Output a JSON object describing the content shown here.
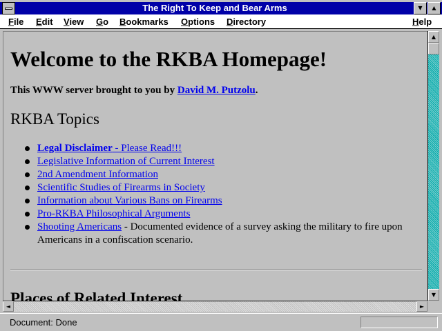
{
  "window": {
    "title": "The Right To Keep and Bear Arms"
  },
  "menu": {
    "file": "File",
    "edit": "Edit",
    "view": "View",
    "go": "Go",
    "bookmarks": "Bookmarks",
    "options": "Options",
    "directory": "Directory",
    "help": "Help"
  },
  "page": {
    "heading": "Welcome to the RKBA Homepage!",
    "byline_prefix": "This WWW server brought to you by ",
    "byline_author": "David M. Putzolu",
    "byline_suffix": ".",
    "topics_heading": "RKBA Topics",
    "topics": [
      {
        "link": "Legal Disclaimer",
        "link_suffix": " - Please Read!!!",
        "desc": ""
      },
      {
        "link": "Legislative Information of Current Interest",
        "link_suffix": "",
        "desc": ""
      },
      {
        "link": "2nd Amendment Information",
        "link_suffix": "",
        "desc": ""
      },
      {
        "link": "Scientific Studies of Firearms in Society",
        "link_suffix": "",
        "desc": ""
      },
      {
        "link": "Information about Various Bans on Firearms",
        "link_suffix": "",
        "desc": ""
      },
      {
        "link": "Pro-RKBA Philosophical Arguments",
        "link_suffix": "",
        "desc": ""
      },
      {
        "link": "Shooting Americans",
        "link_suffix": "",
        "desc": " - Documented evidence of a survey asking the military to fire upon Americans in a confiscation scenario."
      }
    ],
    "places_heading": "Places of Related Interest"
  },
  "status": {
    "text": "Document: Done"
  },
  "icons": {
    "system_menu": "system-menu-icon",
    "minimize": "minimize-icon",
    "maximize": "maximize-icon",
    "scroll_up": "arrow-up-icon",
    "scroll_down": "arrow-down-icon",
    "scroll_left": "arrow-left-icon",
    "scroll_right": "arrow-right-icon",
    "bullet": "bullet-icon"
  },
  "colors": {
    "title_bar": "#0000a8",
    "link": "#0000ee",
    "page_background": "#c0c0c0",
    "scroll_track": "#00a8a8"
  }
}
